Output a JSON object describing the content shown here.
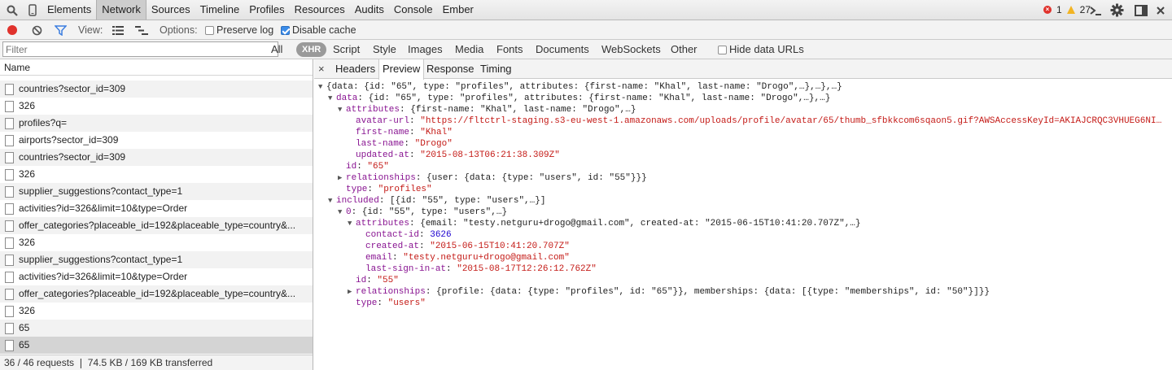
{
  "topbar": {
    "tabs": [
      "Elements",
      "Network",
      "Sources",
      "Timeline",
      "Profiles",
      "Resources",
      "Audits",
      "Console",
      "Ember"
    ],
    "active_tab": "Network",
    "error_count": "1",
    "warning_count": "27"
  },
  "toolbar": {
    "view_label": "View:",
    "options_label": "Options:",
    "preserve_log": "Preserve log",
    "disable_cache": "Disable cache"
  },
  "filterbar": {
    "placeholder": "Filter",
    "types": [
      "All",
      "XHR",
      "Script",
      "Style",
      "Images",
      "Media",
      "Fonts",
      "Documents",
      "WebSockets",
      "Other"
    ],
    "active_type": "XHR",
    "hide_data_urls": "Hide data URLs"
  },
  "requests": {
    "column_name": "Name",
    "rows": [
      "countries?sector_id=309",
      "326",
      "profiles?q=",
      "airports?sector_id=309",
      "countries?sector_id=309",
      "326",
      "supplier_suggestions?contact_type=1",
      "activities?id=326&limit=10&type=Order",
      "offer_categories?placeable_id=192&placeable_type=country&...",
      "326",
      "supplier_suggestions?contact_type=1",
      "activities?id=326&limit=10&type=Order",
      "offer_categories?placeable_id=192&placeable_type=country&...",
      "326",
      "65",
      "65"
    ],
    "status": "36 / 46 requests ❘ 74.5 KB / 169 KB transferred"
  },
  "detail": {
    "close": "×",
    "tabs": [
      "Headers",
      "Preview",
      "Response",
      "Timing"
    ],
    "active_tab": "Preview"
  },
  "preview": {
    "l0": "{data: {id: \"65\", type: \"profiles\", attributes: {first-name: \"Khal\", last-name: \"Drogo\",…},…},…}",
    "l1_key": "data",
    "l1_rest": ": {id: \"65\", type: \"profiles\", attributes: {first-name: \"Khal\", last-name: \"Drogo\",…},…}",
    "l2_key": "attributes",
    "l2_rest": ": {first-name: \"Khal\", last-name: \"Drogo\",…}",
    "avatar_key": "avatar-url",
    "avatar_val": "\"https://fltctrl-staging.s3-eu-west-1.amazonaws.com/uploads/profile/avatar/65/thumb_sfbkkcom6sqaon5.gif?AWSAccessKeyId=AKIAJCRQC3VHUEG6NI…",
    "first_key": "first-name",
    "first_val": "\"Khal\"",
    "last_key": "last-name",
    "last_val": "\"Drogo\"",
    "updated_key": "updated-at",
    "updated_val": "\"2015-08-13T06:21:38.309Z\"",
    "id_key": "id",
    "id_val": "\"65\"",
    "rel_key": "relationships",
    "rel_rest": ": {user: {data: {type: \"users\", id: \"55\"}}}",
    "type_key": "type",
    "type_val": "\"profiles\"",
    "included_key": "included",
    "included_rest": ": [{id: \"55\", type: \"users\",…}]",
    "zero_key": "0",
    "zero_rest": ": {id: \"55\", type: \"users\",…}",
    "attr2_key": "attributes",
    "attr2_rest": ": {email: \"testy.netguru+drogo@gmail.com\", created-at: \"2015-06-15T10:41:20.707Z\",…}",
    "contact_key": "contact-id",
    "contact_val": "3626",
    "created_key": "created-at",
    "created_val": "\"2015-06-15T10:41:20.707Z\"",
    "email_key": "email",
    "email_val": "\"testy.netguru+drogo@gmail.com\"",
    "lastsign_key": "last-sign-in-at",
    "lastsign_val": "\"2015-08-17T12:26:12.762Z\"",
    "id2_key": "id",
    "id2_val": "\"55\"",
    "rel2_key": "relationships",
    "rel2_rest": ": {profile: {data: {type: \"profiles\", id: \"65\"}}, memberships: {data: [{type: \"memberships\", id: \"50\"}]}}",
    "type2_key": "type",
    "type2_val": "\"users\""
  }
}
